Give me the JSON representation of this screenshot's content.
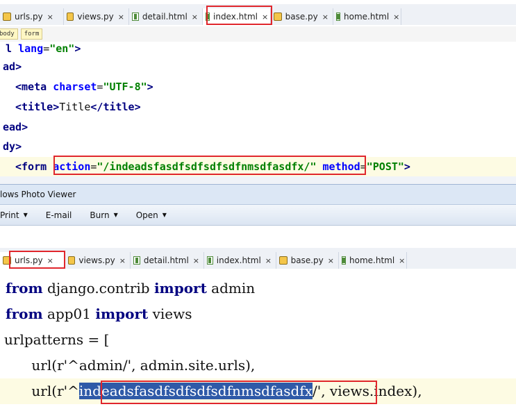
{
  "top_tabs": [
    {
      "label": "urls.py",
      "type": "py"
    },
    {
      "label": "views.py",
      "type": "py"
    },
    {
      "label": "detail.html",
      "type": "html"
    },
    {
      "label": "index.html",
      "type": "html",
      "active": true
    },
    {
      "label": "base.py",
      "type": "py"
    },
    {
      "label": "home.html",
      "type": "html"
    }
  ],
  "close_glyph": "×",
  "breadcrumbs": [
    "body",
    "form"
  ],
  "top_code": {
    "l1": {
      "a": "l ",
      "b": "lang",
      "c": "=",
      "d": "\"en\"",
      "e": ">"
    },
    "l2": {
      "a": "ad",
      "b": ">"
    },
    "l3": {
      "a": "<",
      "b": "meta ",
      "c": "charset",
      "d": "=",
      "e": "\"UTF-8\"",
      "f": ">"
    },
    "l4": {
      "a": "<",
      "b": "title",
      "c": ">",
      "d": "Title",
      "e": "</",
      "f": "title",
      "g": ">"
    },
    "l5": {
      "a": "ead",
      "b": ">"
    },
    "l6": {
      "a": "dy",
      "b": ">"
    },
    "l7": {
      "a": "<",
      "b": "form ",
      "c": "action",
      "d": "=",
      "e": "\"/indeadsfasdfsdfsdfsdfnmsdfasdfx/\"",
      "f": " ",
      "g": "method",
      "h": "=",
      "i": "\"POST\"",
      "j": ">"
    }
  },
  "viewer": {
    "title": "lows Photo Viewer",
    "menu": [
      {
        "label": "Print",
        "arrow": true
      },
      {
        "label": "E-mail",
        "arrow": false
      },
      {
        "label": "Burn",
        "arrow": true
      },
      {
        "label": "Open",
        "arrow": true
      }
    ],
    "arrow_glyph": "▼"
  },
  "bottom_tabs": [
    {
      "label": "urls.py",
      "type": "py",
      "active": true
    },
    {
      "label": "views.py",
      "type": "py"
    },
    {
      "label": "detail.html",
      "type": "html"
    },
    {
      "label": "index.html",
      "type": "html"
    },
    {
      "label": "base.py",
      "type": "py"
    },
    {
      "label": "home.html",
      "type": "html"
    }
  ],
  "bottom_code": {
    "l1": {
      "a": "from",
      "b": " django.contrib ",
      "c": "import",
      "d": " admin"
    },
    "l2": {
      "a": "from",
      "b": " app01 ",
      "c": "import",
      "d": " views"
    },
    "l3": {
      "a": "urlpatterns = ["
    },
    "l4": {
      "a": "    url(r'^admin/', admin.site.urls),"
    },
    "l5": {
      "a": "    url(r'^",
      "b": "indeadsfasdfsdfsdfsdfnmsdfasdfx",
      "c": "/', views.index),"
    }
  }
}
